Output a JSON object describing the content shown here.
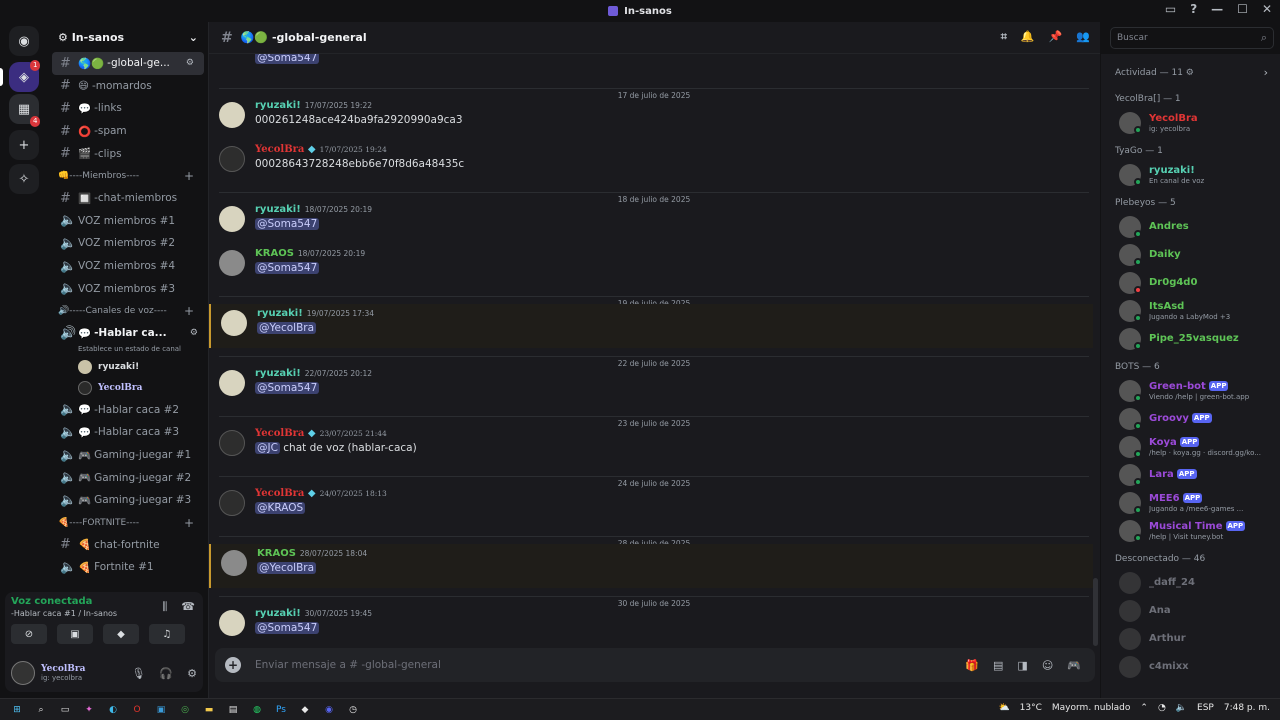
{
  "window": {
    "title": "In-sanos"
  },
  "servers": {
    "badge_active": "1",
    "badge_group": "4"
  },
  "guild": {
    "name": "In-sanos"
  },
  "channels": [
    {
      "name": "-global-ge...",
      "selected": true
    },
    {
      "name": "-momardos"
    },
    {
      "name": "-links"
    },
    {
      "name": "-spam"
    },
    {
      "name": "-clips"
    }
  ],
  "category_members": "----Miembros----",
  "members_channels": [
    "-chat-miembros",
    "VOZ miembros #1",
    "VOZ miembros #2",
    "VOZ miembros #4",
    "VOZ miembros #3"
  ],
  "category_voice": "-----Canales de voz----",
  "voice_active": {
    "name": "-Hablar ca...",
    "status_hint": "Establece un estado de canal",
    "users": [
      "ryuzaki!",
      "YecolBra"
    ]
  },
  "voice_channels": [
    "-Hablar caca #2",
    "-Hablar caca #3",
    "Gaming-juegar #1",
    "Gaming-juegar #2",
    "Gaming-juegar #3"
  ],
  "category_fortnite": "----FORTNITE----",
  "fortnite_channels": [
    "chat-fortnite",
    "Fortnite #1"
  ],
  "voice_panel": {
    "status": "Voz conectada",
    "channel": "-Hablar caca #1 / In-sanos"
  },
  "user_panel": {
    "name": "YecolBra",
    "status": "ig: yecolbra"
  },
  "chat": {
    "channel": "-global-general",
    "top_mention": "@Soma547",
    "composer_placeholder": "Enviar mensaje a #  -global-general"
  },
  "messages": [
    {
      "date": "17 de julio de 2025"
    },
    {
      "author": "ryuzaki!",
      "style": "ryu",
      "time": "17/07/2025 19:22",
      "text": "000261248ace424ba9fa2920990a9ca3"
    },
    {
      "author": "YecolBra",
      "style": "yec",
      "time": "17/07/2025 19:24",
      "text": "00028643728248ebb6e70f8d6a48435c"
    },
    {
      "date": "18 de julio de 2025"
    },
    {
      "author": "ryuzaki!",
      "style": "ryu",
      "time": "18/07/2025 20:19",
      "mention": "@Soma547"
    },
    {
      "author": "KRAOS",
      "style": "kra",
      "time": "18/07/2025 20:19",
      "mention": "@Soma547"
    },
    {
      "date": "19 de julio de 2025"
    },
    {
      "author": "ryuzaki!",
      "style": "ryu",
      "time": "19/07/2025 17:34",
      "mention": "@YecolBra",
      "highlight": true
    },
    {
      "date": "22 de julio de 2025"
    },
    {
      "author": "ryuzaki!",
      "style": "ryu",
      "time": "22/07/2025 20:12",
      "mention": "@Soma547"
    },
    {
      "date": "23 de julio de 2025"
    },
    {
      "author": "YecolBra",
      "style": "yec",
      "time": "23/07/2025 21:44",
      "mention": "@JC",
      "text": "chat de voz (hablar-caca)"
    },
    {
      "date": "24 de julio de 2025"
    },
    {
      "author": "YecolBra",
      "style": "yec",
      "time": "24/07/2025 18:13",
      "mention": "@KRAOS"
    },
    {
      "date": "28 de julio de 2025"
    },
    {
      "author": "KRAOS",
      "style": "kra",
      "time": "28/07/2025 18:04",
      "mention": "@YecolBra",
      "highlight": true
    },
    {
      "date": "30 de julio de 2025"
    },
    {
      "author": "ryuzaki!",
      "style": "ryu",
      "time": "30/07/2025 19:45",
      "mention": "@Soma547"
    }
  ],
  "search": {
    "placeholder": "Buscar"
  },
  "members_panel": {
    "activity": "Actividad — 11",
    "sections": [
      {
        "title": "YecolBra[] — 1",
        "members": [
          {
            "name": "YecolBra",
            "activity": "ig: yecolbra",
            "color": "#e03535"
          }
        ]
      },
      {
        "title": "TyaGo — 1",
        "members": [
          {
            "name": "ryuzaki!",
            "activity": "En canal de voz",
            "color": "#57d1b3"
          }
        ]
      },
      {
        "title": "Plebeyos — 5",
        "members": [
          {
            "name": "Andres",
            "color": "#5ec456"
          },
          {
            "name": "Daiky",
            "color": "#5ec456"
          },
          {
            "name": "Dr0g4d0",
            "color": "#5ec456"
          },
          {
            "name": "ItsAsd",
            "activity": "Jugando a LabyMod +3",
            "color": "#5ec456"
          },
          {
            "name": "Pipe_25vasquez",
            "color": "#5ec456"
          }
        ]
      },
      {
        "title": "BOTS — 6",
        "members": [
          {
            "name": "Green-bot",
            "activity": "Viendo /help | green-bot.app",
            "color": "#9b4ad8",
            "app": "APP"
          },
          {
            "name": "Groovy",
            "color": "#9b4ad8",
            "app": "APP"
          },
          {
            "name": "Koya",
            "activity": "/help · koya.gg · discord.gg/ko...",
            "color": "#9b4ad8",
            "app": "APP"
          },
          {
            "name": "Lara",
            "color": "#9b4ad8",
            "app": "APP"
          },
          {
            "name": "MEE6",
            "activity": "Jugando a /mee6-games ...",
            "color": "#9b4ad8",
            "app": "APP"
          },
          {
            "name": "Musical Time",
            "activity": "/help | Visit tuney.bot",
            "color": "#9b4ad8",
            "app": "APP"
          }
        ]
      },
      {
        "title": "Desconectado — 46",
        "members": [
          {
            "name": "_daff_24",
            "color": "#6d6f78"
          },
          {
            "name": "Ana",
            "color": "#6d6f78"
          },
          {
            "name": "Arthur",
            "color": "#6d6f78"
          },
          {
            "name": "c4mixx",
            "color": "#6d6f78"
          }
        ]
      }
    ]
  },
  "taskbar": {
    "weather_temp": "13°C",
    "weather_desc": "Mayorm. nublado",
    "lang": "ESP",
    "clock": "7:48 p. m."
  }
}
